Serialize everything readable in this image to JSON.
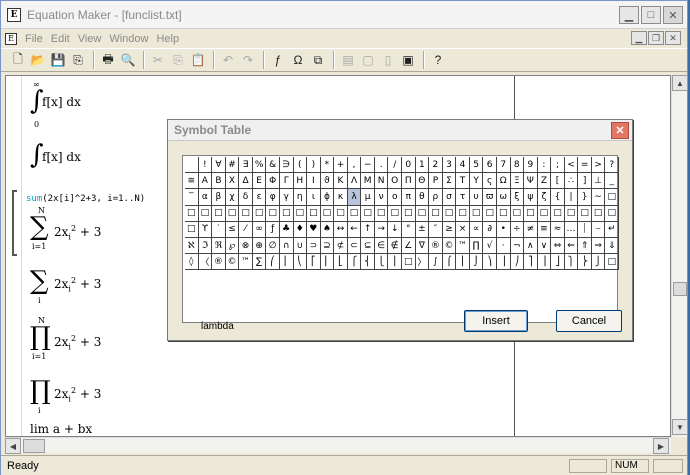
{
  "window": {
    "title": "Equation Maker - [funclist.txt]"
  },
  "menu": [
    "File",
    "Edit",
    "View",
    "Window",
    "Help"
  ],
  "toolbar": {
    "icons": [
      "new-file-icon",
      "open-file-icon",
      "save-icon",
      "copy-icon",
      "print-icon",
      "print-preview-icon",
      "cut-icon",
      "paste-icon",
      "undo-icon",
      "redo-icon",
      "function-icon",
      "omega-icon",
      "symbol-icon",
      "insert-doc-icon",
      "page-icon",
      "page2-icon",
      "toggle-icon",
      "help-icon"
    ]
  },
  "document": {
    "eq1": "f[x] dx",
    "eq1_upper": "∞",
    "eq1_lower": "0",
    "eq2": "f[x] dx",
    "source_kw": "sum",
    "source_rest": "(2x[i]^2+3, i=1..N)",
    "eq3_upper": "N",
    "eq3_lower": "i=1",
    "eq3": "2x",
    "eq3_sub": "i",
    "eq3_sup": "2",
    "eq3_tail": "+ 3",
    "eq4_lower": "i",
    "eq4": "2x",
    "eq4_sub": "i",
    "eq4_sup": "2",
    "eq4_tail": "+ 3",
    "eq5_upper": "N",
    "eq5_lower": "i=1",
    "eq5": "2x",
    "eq5_sub": "i",
    "eq5_sup": "2",
    "eq5_tail": "+ 3",
    "eq6_lower": "i",
    "eq6": "2x",
    "eq6_sub": "i",
    "eq6_sup": "2",
    "eq6_tail": "+ 3",
    "eq7": "lim   a + bx"
  },
  "dialog": {
    "title": "Symbol Table",
    "selected_name": "lambda",
    "insert_label": "Insert",
    "cancel_label": "Cancel",
    "rows": [
      [
        " ",
        "!",
        "∀",
        "#",
        "∃",
        "%",
        "&",
        "∋",
        "(",
        ")",
        "*",
        "+",
        ",",
        "−",
        ".",
        "/",
        "0",
        "1",
        "2",
        "3",
        "4",
        "5",
        "6",
        "7",
        "8",
        "9",
        ":",
        ";",
        "<",
        "=",
        ">",
        "?"
      ],
      [
        "≅",
        "Α",
        "Β",
        "Χ",
        "Δ",
        "Ε",
        "Φ",
        "Γ",
        "Η",
        "Ι",
        "ϑ",
        "Κ",
        "Λ",
        "Μ",
        "Ν",
        "Ο",
        "Π",
        "Θ",
        "Ρ",
        "Σ",
        "Τ",
        "Υ",
        "ς",
        "Ω",
        "Ξ",
        "Ψ",
        "Ζ",
        "[",
        "∴",
        "]",
        "⊥",
        "_"
      ],
      [
        "‾",
        "α",
        "β",
        "χ",
        "δ",
        "ε",
        "φ",
        "γ",
        "η",
        "ι",
        "ϕ",
        "κ",
        "λ",
        "μ",
        "ν",
        "ο",
        "π",
        "θ",
        "ρ",
        "σ",
        "τ",
        "υ",
        "ϖ",
        "ω",
        "ξ",
        "ψ",
        "ζ",
        "{",
        "|",
        "}",
        "∼",
        "□"
      ],
      [
        "□",
        "□",
        "□",
        "□",
        "□",
        "□",
        "□",
        "□",
        "□",
        "□",
        "□",
        "□",
        "□",
        "□",
        "□",
        "□",
        "□",
        "□",
        "□",
        "□",
        "□",
        "□",
        "□",
        "□",
        "□",
        "□",
        "□",
        "□",
        "□",
        "□",
        "□",
        "□"
      ],
      [
        "□",
        "ϒ",
        "′",
        "≤",
        "⁄",
        "∞",
        "ƒ",
        "♣",
        "♦",
        "♥",
        "♠",
        "↔",
        "←",
        "↑",
        "→",
        "↓",
        "°",
        "±",
        "″",
        "≥",
        "×",
        "∝",
        "∂",
        "•",
        "÷",
        "≠",
        "≡",
        "≈",
        "…",
        "⏐",
        "⎯",
        "↵"
      ],
      [
        "ℵ",
        "ℑ",
        "ℜ",
        "℘",
        "⊗",
        "⊕",
        "∅",
        "∩",
        "∪",
        "⊃",
        "⊇",
        "⊄",
        "⊂",
        "⊆",
        "∈",
        "∉",
        "∠",
        "∇",
        "®",
        "©",
        "™",
        "∏",
        "√",
        "⋅",
        "¬",
        "∧",
        "∨",
        "⇔",
        "⇐",
        "⇑",
        "⇒",
        "⇓"
      ],
      [
        "◊",
        "〈",
        "®",
        "©",
        "™",
        "∑",
        "⎛",
        "⎜",
        "⎝",
        "⎡",
        "⎢",
        "⎣",
        "⎧",
        "⎨",
        "⎩",
        "⎪",
        "□",
        "〉",
        "∫",
        "⌠",
        "⎮",
        "⌡",
        "⎞",
        "⎟",
        "⎠",
        "⎤",
        "⎥",
        "⎦",
        "⎫",
        "⎬",
        "⎭",
        "□"
      ]
    ]
  },
  "status": {
    "text": "Ready",
    "num": "NUM"
  }
}
